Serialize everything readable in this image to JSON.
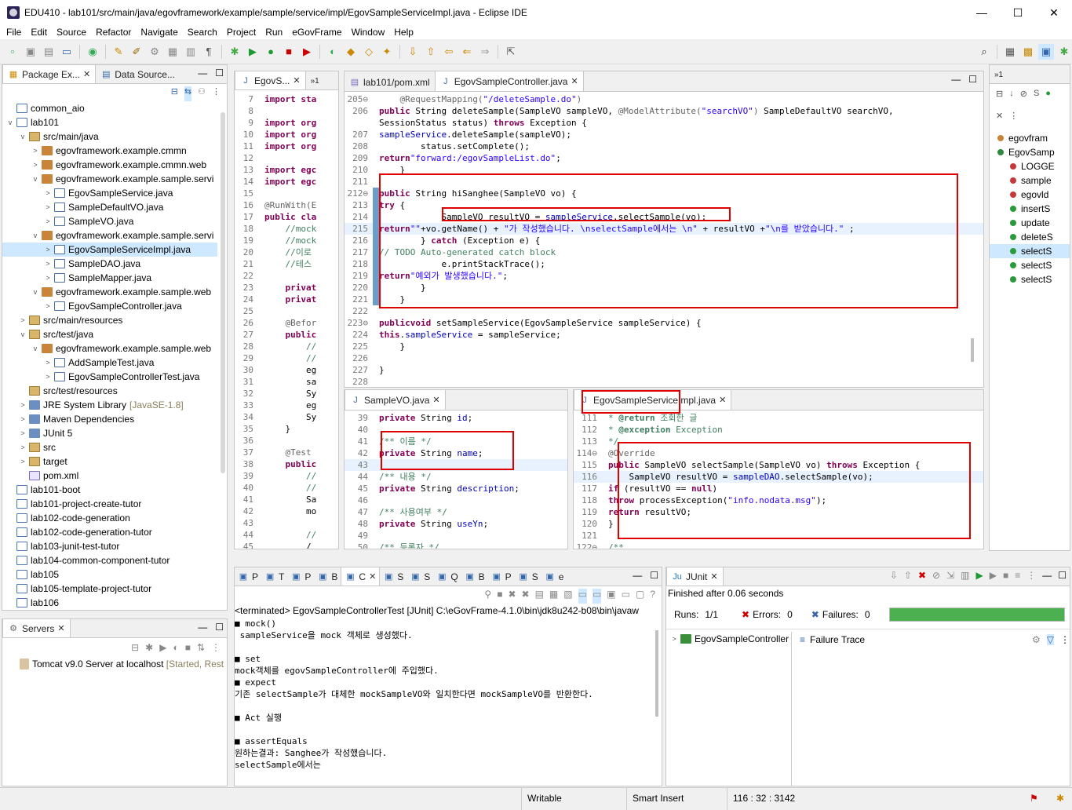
{
  "window": {
    "title": "EDU410 - lab101/src/main/java/egovframework/example/sample/service/impl/EgovSampleServiceImpl.java - Eclipse IDE",
    "min": "—",
    "max": "☐",
    "close": "✕"
  },
  "menu": [
    "File",
    "Edit",
    "Source",
    "Refactor",
    "Navigate",
    "Search",
    "Project",
    "Run",
    "eGovFrame",
    "Window",
    "Help"
  ],
  "explorer": {
    "tabs": [
      "Package Ex...",
      "Data Source..."
    ],
    "rows": [
      {
        "t": "common_aio",
        "i": 0,
        "ic": "proj",
        "tw": ""
      },
      {
        "t": "lab101",
        "i": 0,
        "ic": "proj",
        "tw": "v"
      },
      {
        "t": "src/main/java",
        "i": 1,
        "ic": "src",
        "tw": "v"
      },
      {
        "t": "egovframework.example.cmmn",
        "i": 2,
        "ic": "pkg",
        "tw": ">"
      },
      {
        "t": "egovframework.example.cmmn.web",
        "i": 2,
        "ic": "pkg",
        "tw": ">"
      },
      {
        "t": "egovframework.example.sample.servi",
        "i": 2,
        "ic": "pkg",
        "tw": "v"
      },
      {
        "t": "EgovSampleService.java",
        "i": 3,
        "ic": "java",
        "tw": ">"
      },
      {
        "t": "SampleDefaultVO.java",
        "i": 3,
        "ic": "java",
        "tw": ">"
      },
      {
        "t": "SampleVO.java",
        "i": 3,
        "ic": "java",
        "tw": ">"
      },
      {
        "t": "egovframework.example.sample.servi",
        "i": 2,
        "ic": "pkg",
        "tw": "v"
      },
      {
        "t": "EgovSampleServiceImpl.java",
        "i": 3,
        "ic": "java",
        "tw": ">",
        "sel": true
      },
      {
        "t": "SampleDAO.java",
        "i": 3,
        "ic": "java",
        "tw": ">"
      },
      {
        "t": "SampleMapper.java",
        "i": 3,
        "ic": "java",
        "tw": ">"
      },
      {
        "t": "egovframework.example.sample.web",
        "i": 2,
        "ic": "pkg",
        "tw": "v"
      },
      {
        "t": "EgovSampleController.java",
        "i": 3,
        "ic": "java",
        "tw": ">"
      },
      {
        "t": "src/main/resources",
        "i": 1,
        "ic": "src",
        "tw": ">"
      },
      {
        "t": "src/test/java",
        "i": 1,
        "ic": "src",
        "tw": "v"
      },
      {
        "t": "egovframework.example.sample.web",
        "i": 2,
        "ic": "pkg",
        "tw": "v"
      },
      {
        "t": "AddSampleTest.java",
        "i": 3,
        "ic": "java",
        "tw": ">"
      },
      {
        "t": "EgovSampleControllerTest.java",
        "i": 3,
        "ic": "java",
        "tw": ">"
      },
      {
        "t": "src/test/resources",
        "i": 1,
        "ic": "src",
        "tw": ""
      },
      {
        "t": "JRE System Library",
        "i": 1,
        "ic": "lib",
        "tw": ">",
        "dec": "[JavaSE-1.8]"
      },
      {
        "t": "Maven Dependencies",
        "i": 1,
        "ic": "lib",
        "tw": ">"
      },
      {
        "t": "JUnit 5",
        "i": 1,
        "ic": "lib",
        "tw": ">"
      },
      {
        "t": "src",
        "i": 1,
        "ic": "src",
        "tw": ">"
      },
      {
        "t": "target",
        "i": 1,
        "ic": "src",
        "tw": ">"
      },
      {
        "t": "pom.xml",
        "i": 1,
        "ic": "xml",
        "tw": ""
      },
      {
        "t": "lab101-boot",
        "i": 0,
        "ic": "proj",
        "tw": ""
      },
      {
        "t": "lab101-project-create-tutor",
        "i": 0,
        "ic": "proj",
        "tw": ""
      },
      {
        "t": "lab102-code-generation",
        "i": 0,
        "ic": "proj",
        "tw": ""
      },
      {
        "t": "lab102-code-generation-tutor",
        "i": 0,
        "ic": "proj",
        "tw": ""
      },
      {
        "t": "lab103-junit-test-tutor",
        "i": 0,
        "ic": "proj",
        "tw": ""
      },
      {
        "t": "lab104-common-component-tutor",
        "i": 0,
        "ic": "proj",
        "tw": ""
      },
      {
        "t": "lab105",
        "i": 0,
        "ic": "proj",
        "tw": ""
      },
      {
        "t": "lab105-template-project-tutor",
        "i": 0,
        "ic": "proj",
        "tw": ""
      },
      {
        "t": "lab106",
        "i": 0,
        "ic": "proj",
        "tw": ""
      }
    ]
  },
  "servers": {
    "tab": "Servers",
    "item": "Tomcat v9.0 Server at localhost",
    "state": "[Started, Rest"
  },
  "editor1": {
    "tab": "EgovS...",
    "more": "»1",
    "lines": [
      [
        "7",
        "import sta"
      ],
      [
        "8",
        ""
      ],
      [
        "9",
        "import org"
      ],
      [
        "10",
        "import org"
      ],
      [
        "11",
        "import org"
      ],
      [
        "12",
        ""
      ],
      [
        "13",
        "import egc"
      ],
      [
        "14",
        "import egc"
      ],
      [
        "15",
        ""
      ],
      [
        "16",
        "@RunWith(E"
      ],
      [
        "17",
        "public cla"
      ],
      [
        "18",
        "    //mock"
      ],
      [
        "19",
        "    //mock"
      ],
      [
        "20",
        "    //이로"
      ],
      [
        "21",
        "    //테스"
      ],
      [
        "22",
        ""
      ],
      [
        "23",
        "    privat"
      ],
      [
        "24",
        "    privat"
      ],
      [
        "25",
        ""
      ],
      [
        "26",
        "    @Befor"
      ],
      [
        "27",
        "    public"
      ],
      [
        "28",
        "        //"
      ],
      [
        "29",
        "        //"
      ],
      [
        "30",
        "        eg"
      ],
      [
        "31",
        "        sa"
      ],
      [
        "32",
        "        Sy"
      ],
      [
        "33",
        "        eg"
      ],
      [
        "34",
        "        Sy"
      ],
      [
        "35",
        "    }"
      ],
      [
        "36",
        ""
      ],
      [
        "37",
        "    @Test"
      ],
      [
        "38",
        "    public"
      ],
      [
        "39",
        "        //"
      ],
      [
        "40",
        "        //"
      ],
      [
        "41",
        "        Sa"
      ],
      [
        "42",
        "        mo"
      ],
      [
        "43",
        ""
      ],
      [
        "44",
        "        //"
      ],
      [
        "45",
        "        /"
      ]
    ]
  },
  "editor2": {
    "tabs": [
      "lab101/pom.xml",
      "EgovSampleController.java"
    ]
  },
  "editor3": {
    "tab": "SampleVO.java"
  },
  "editor4": {
    "tab": "EgovSampleServiceImpl.java"
  },
  "console": {
    "tabs": [
      "P",
      "T",
      "P",
      "B",
      "C",
      "S",
      "S",
      "Q",
      "B",
      "P",
      "S",
      "e"
    ],
    "header": "<terminated> EgovSampleControllerTest [JUnit] C:\\eGovFrame-4.1.0\\bin\\jdk8u242-b08\\bin\\javaw",
    "lines": [
      "■ mock()",
      " sampleService을 mock 객체로 생성했다.",
      "",
      "■ set",
      "mock객체를 egovSampleController에 주입했다.",
      "■ expect",
      "기존 selectSample가 대체한 mockSampleVO와 일치한다면 mockSampleVO를 반환한다.",
      "",
      "■ Act 실행",
      "",
      "■ assertEquals",
      "원하는결과: Sanghee가 작성했습니다.",
      "selectSample에서는"
    ]
  },
  "junit": {
    "tab": "JUnit",
    "finished": "Finished after 0.06 seconds",
    "runs_label": "Runs:",
    "runs": "1/1",
    "errors_label": "Errors:",
    "errors": "0",
    "failures_label": "Failures:",
    "failures": "0",
    "progress": 1.0,
    "tree_item": "EgovSampleController",
    "trace": "Failure Trace"
  },
  "outline": {
    "more": "»1",
    "items": [
      "egovfram",
      "EgovSamp",
      "LOGGE",
      "sample",
      "egovld",
      "insertS",
      "update",
      "deleteS",
      "selectS",
      "selectS",
      "selectS"
    ]
  },
  "statusbar": {
    "mode": "Writable",
    "insert": "Smart Insert",
    "pos": "116 : 32 : 3142"
  }
}
